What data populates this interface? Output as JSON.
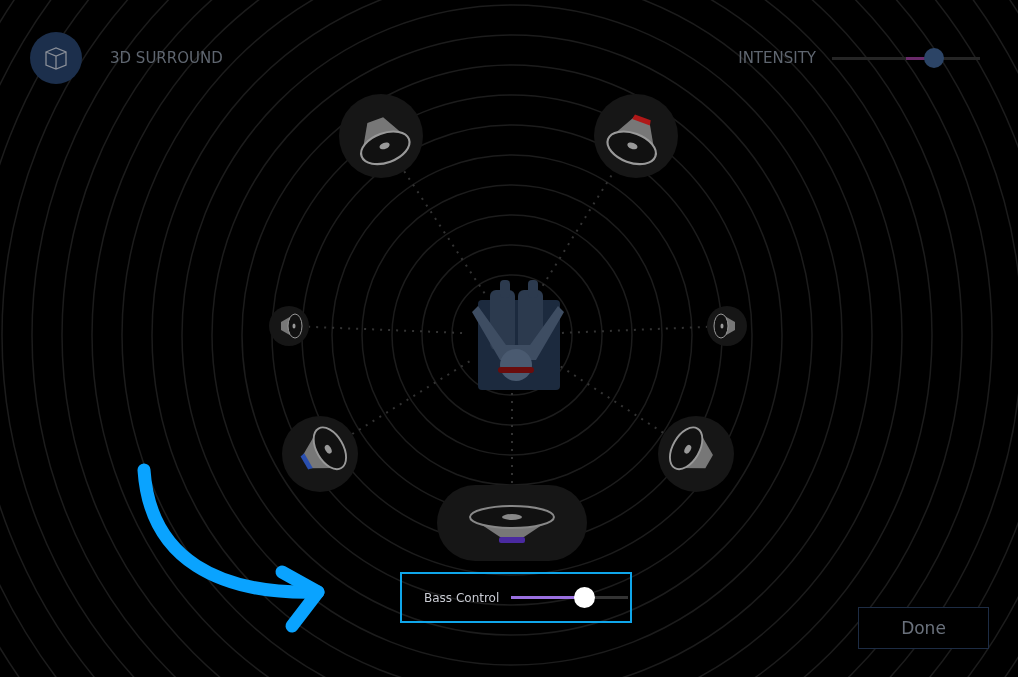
{
  "header": {
    "title": "3D SURROUND",
    "intensity": {
      "label": "INTENSITY",
      "level": 0.69
    }
  },
  "speakers": [
    {
      "kind": "front"
    },
    {
      "kind": "front",
      "color": "#b01818"
    },
    {
      "kind": "side"
    },
    {
      "kind": "side"
    },
    {
      "kind": "rear",
      "color": "#2a4fb0"
    },
    {
      "kind": "rear"
    },
    {
      "kind": "sub",
      "color": "#4a2aa0"
    }
  ],
  "bass": {
    "label": "Bass Control",
    "level": 0.62
  },
  "done_button": "Done"
}
